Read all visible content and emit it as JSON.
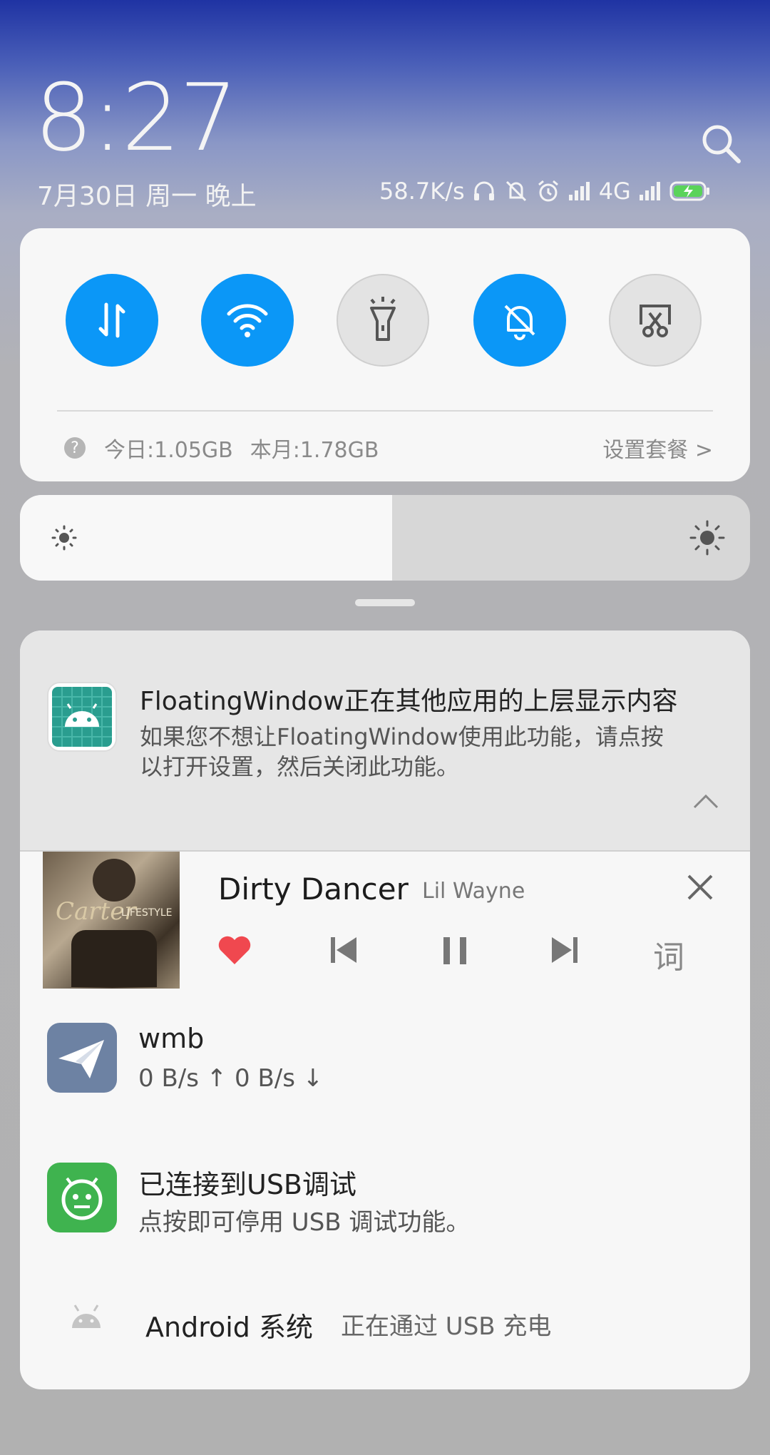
{
  "header": {
    "time": "8:27",
    "date": "7月30日 周一 晚上",
    "net_speed": "58.7K/s",
    "network_type": "4G"
  },
  "quick_settings": {
    "toggles": [
      {
        "name": "mobile-data",
        "state": "on"
      },
      {
        "name": "wifi",
        "state": "on"
      },
      {
        "name": "flashlight",
        "state": "off"
      },
      {
        "name": "silent",
        "state": "on"
      },
      {
        "name": "screenshot",
        "state": "off"
      }
    ],
    "data_today": "今日:1.05GB",
    "data_month": "本月:1.78GB",
    "plan_link": "设置套餐 >"
  },
  "brightness": {
    "level": 0.51
  },
  "notifications": {
    "floating": {
      "title": "FloatingWindow正在其他应用的上层显示内容",
      "text_line1": "如果您不想让FloatingWindow使用此功能，请点按",
      "text_line2": "以打开设置，然后关闭此功能。"
    },
    "music": {
      "song": "Dirty  Dancer",
      "artist": "Lil Wayne",
      "lyric_button": "词",
      "cover_text": "Carter",
      "cover_subtext": "LIFESTYLE"
    },
    "vpn": {
      "title": "wmb",
      "speed": "0 B/s ↑   0 B/s ↓"
    },
    "usb_debug": {
      "title": "已连接到USB调试",
      "text": "点按即可停用 USB 调试功能。"
    },
    "android_system": {
      "app": "Android  系统",
      "text": "正在通过 USB 充电"
    }
  },
  "colors": {
    "accent": "#0b97f7",
    "favorite": "#f0484f",
    "usb_icon": "#3fb34f",
    "vpn_icon": "#6d82a3",
    "floating_icon": "#2a9d8f"
  }
}
